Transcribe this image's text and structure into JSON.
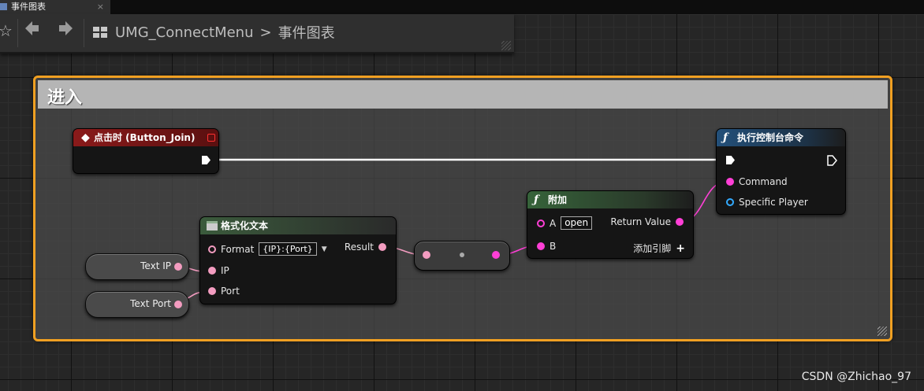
{
  "tab": {
    "title": "事件图表",
    "close": "×"
  },
  "toolbar": {
    "breadcrumb_blueprint": "UMG_ConnectMenu",
    "breadcrumb_sep": ">",
    "breadcrumb_graph": "事件图表"
  },
  "comment": {
    "title": "进入"
  },
  "nodes": {
    "event": {
      "title": "点击时 (Button_Join)"
    },
    "format_text": {
      "title": "格式化文本",
      "format_label": "Format",
      "format_value": "{IP}:{Port}",
      "ip_label": "IP",
      "port_label": "Port",
      "result_label": "Result"
    },
    "append": {
      "title": "附加",
      "a_label": "A",
      "a_value": "open",
      "b_label": "B",
      "return_label": "Return Value",
      "add_pin_label": "添加引脚"
    },
    "exec_cmd": {
      "title": "执行控制台命令",
      "command_label": "Command",
      "player_label": "Specific Player"
    },
    "var_ip": {
      "label": "Text IP"
    },
    "var_port": {
      "label": "Text Port"
    }
  },
  "colors": {
    "comment_border": "#f0a022",
    "event_header": "#8a1a1a",
    "function_header": "#23507a",
    "pure_function_header": "#36633a",
    "string_pin": "#ff3fd6",
    "text_pin": "#f39cc0",
    "object_pin": "#33aaff"
  },
  "watermark": "CSDN @Zhichao_97"
}
